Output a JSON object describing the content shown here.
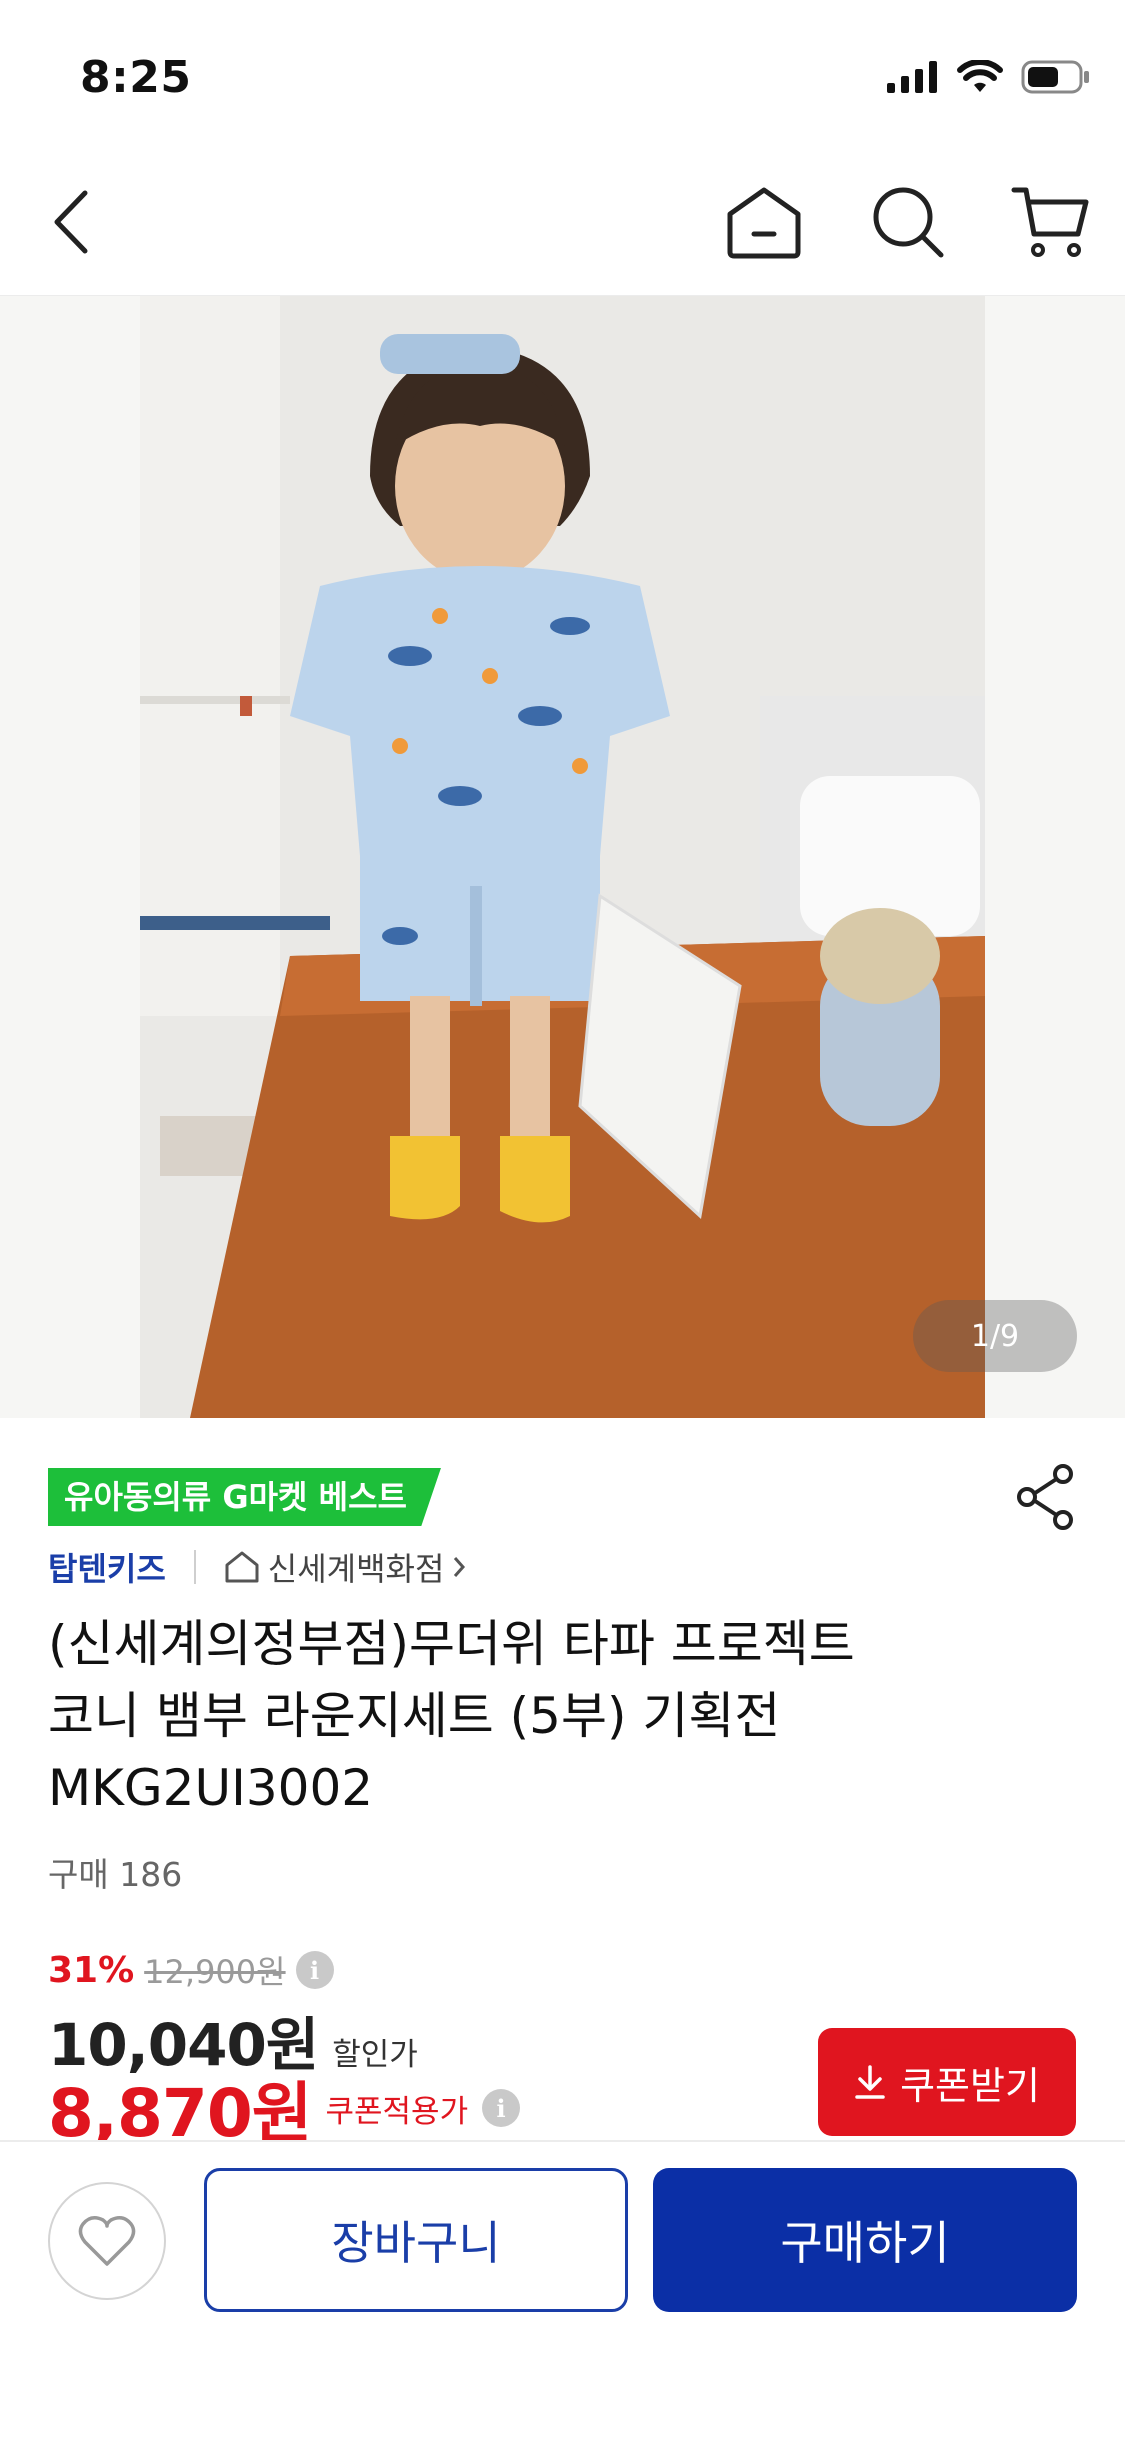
{
  "status_bar": {
    "time": "8:25"
  },
  "nav": {
    "back_icon": "chevron-left-icon",
    "home_icon": "home-icon",
    "search_icon": "search-icon",
    "cart_icon": "cart-icon"
  },
  "gallery": {
    "counter": "1/9",
    "total_images": 9,
    "current_image": 1
  },
  "product": {
    "badge": "유아동의류 G마켓 베스트",
    "brand": "탑텐키즈",
    "store": "신세계백화점",
    "title": "(신세계의정부점)무더위 타파 프로젝트\n코니 뱀부 라운지세트 (5부) 기획전\nMKG2UI3002",
    "purchase_count": "구매 186"
  },
  "price": {
    "discount_rate": "31%",
    "original_price": "12,900원",
    "sale_price": "10,040원",
    "sale_label": "할인가",
    "coupon_price": "8,870원",
    "coupon_label": "쿠폰적용가",
    "info_icon": "i"
  },
  "actions": {
    "coupon_button": "쿠폰받기",
    "cart_button": "장바구니",
    "buy_button": "구매하기"
  },
  "colors": {
    "brand_blue": "#0b2fa6",
    "accent_red": "#e0151f",
    "badge_green": "#1dbf3a"
  }
}
